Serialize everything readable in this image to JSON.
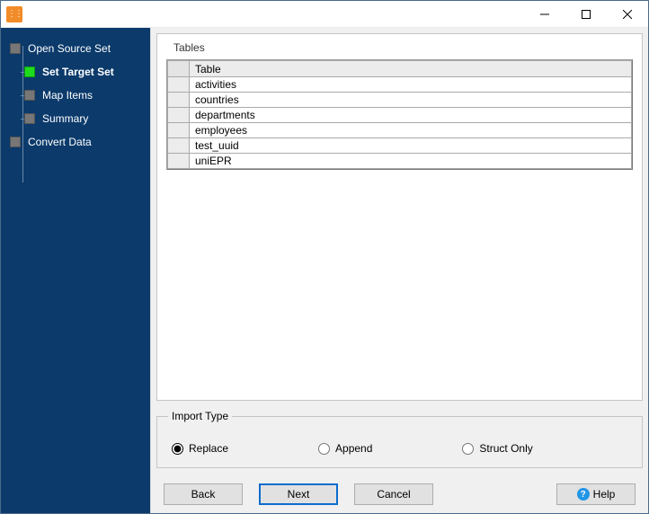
{
  "sidebar": {
    "items": [
      {
        "label": "Open Source Set",
        "child": false,
        "current": false,
        "active": false
      },
      {
        "label": "Set Target Set",
        "child": true,
        "current": true,
        "active": true
      },
      {
        "label": "Map Items",
        "child": true,
        "current": false,
        "active": false
      },
      {
        "label": "Summary",
        "child": true,
        "current": false,
        "active": false
      },
      {
        "label": "Convert Data",
        "child": false,
        "current": false,
        "active": false
      }
    ]
  },
  "tables": {
    "title": "Tables",
    "column_header": "Table",
    "rows": [
      "activities",
      "countries",
      "departments",
      "employees",
      "test_uuid",
      "uniEPR"
    ]
  },
  "import_type": {
    "title": "Import Type",
    "options": [
      {
        "label": "Replace",
        "selected": true
      },
      {
        "label": "Append",
        "selected": false
      },
      {
        "label": "Struct Only",
        "selected": false
      }
    ]
  },
  "buttons": {
    "back": "Back",
    "next": "Next",
    "cancel": "Cancel",
    "help": "Help"
  }
}
